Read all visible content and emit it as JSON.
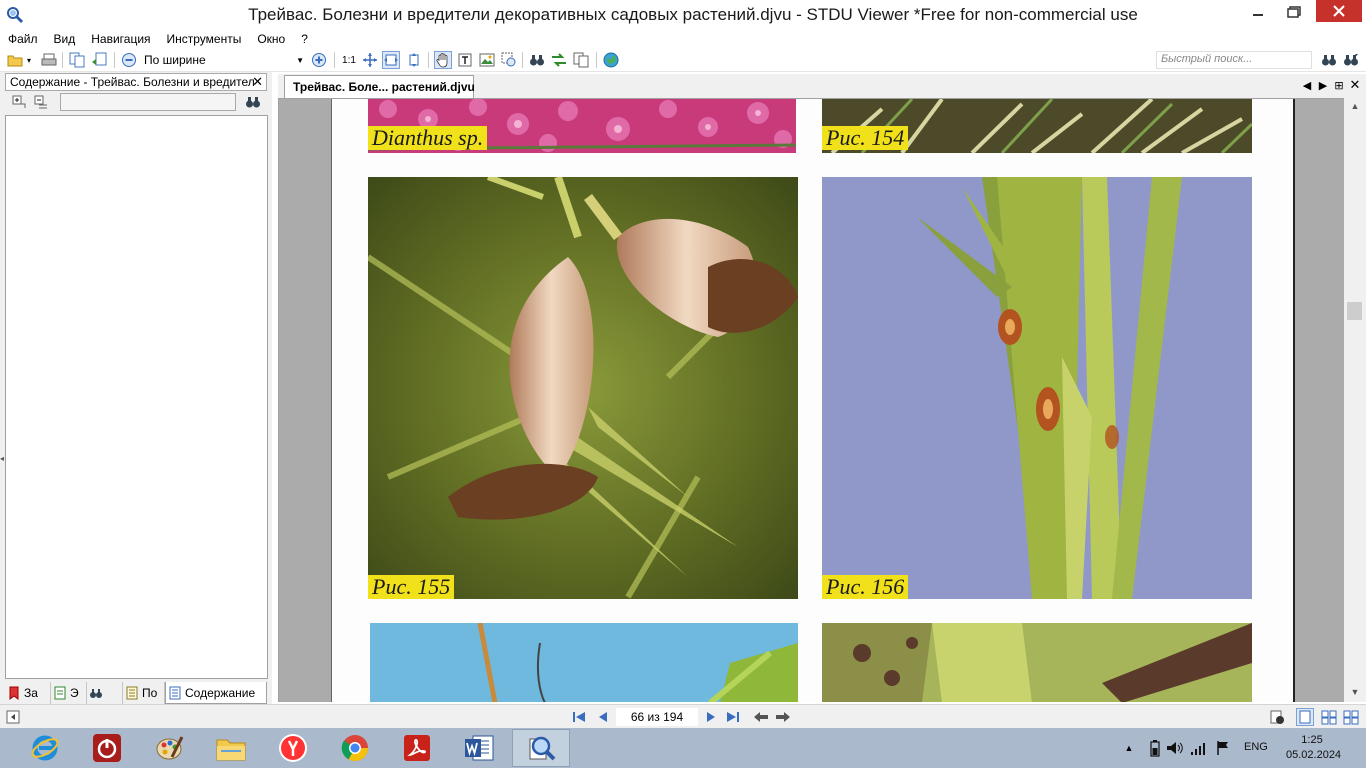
{
  "window": {
    "title": "Трейвас. Болезни и вредители декоративных садовых растений.djvu - STDU Viewer *Free for non-commercial use"
  },
  "menu": [
    {
      "label": "Файл"
    },
    {
      "label": "Вид"
    },
    {
      "label": "Навигация"
    },
    {
      "label": "Инструменты"
    },
    {
      "label": "Окно"
    },
    {
      "label": "?"
    }
  ],
  "toolbar": {
    "zoom_value": "По ширине",
    "zoom_1to1": "1:1",
    "quick_search_placeholder": "Быстрый поиск..."
  },
  "left_panel": {
    "header": "Содержание - Трейвас. Болезни и вредител",
    "tabs": [
      {
        "label": "За"
      },
      {
        "label": "Э"
      },
      {
        "label": ""
      },
      {
        "label": "По"
      },
      {
        "label": "Содержание"
      }
    ]
  },
  "document": {
    "tab_label": "Трейвас. Боле... растений.djvu",
    "captions": {
      "top_left": "Dianthus sp.",
      "top_right": "Рис. 154",
      "mid_left": "Рис. 155",
      "mid_right": "Рис. 156"
    }
  },
  "statusbar": {
    "page_indicator": "66 из 194"
  },
  "taskbar": {
    "lang": "ENG",
    "time": "1:25",
    "date": "05.02.2024"
  },
  "colors": {
    "caption_bg": "#f1e11b",
    "close_button": "#c7312b",
    "taskbar": "#aab9cb",
    "doc_background": "#ababab"
  }
}
